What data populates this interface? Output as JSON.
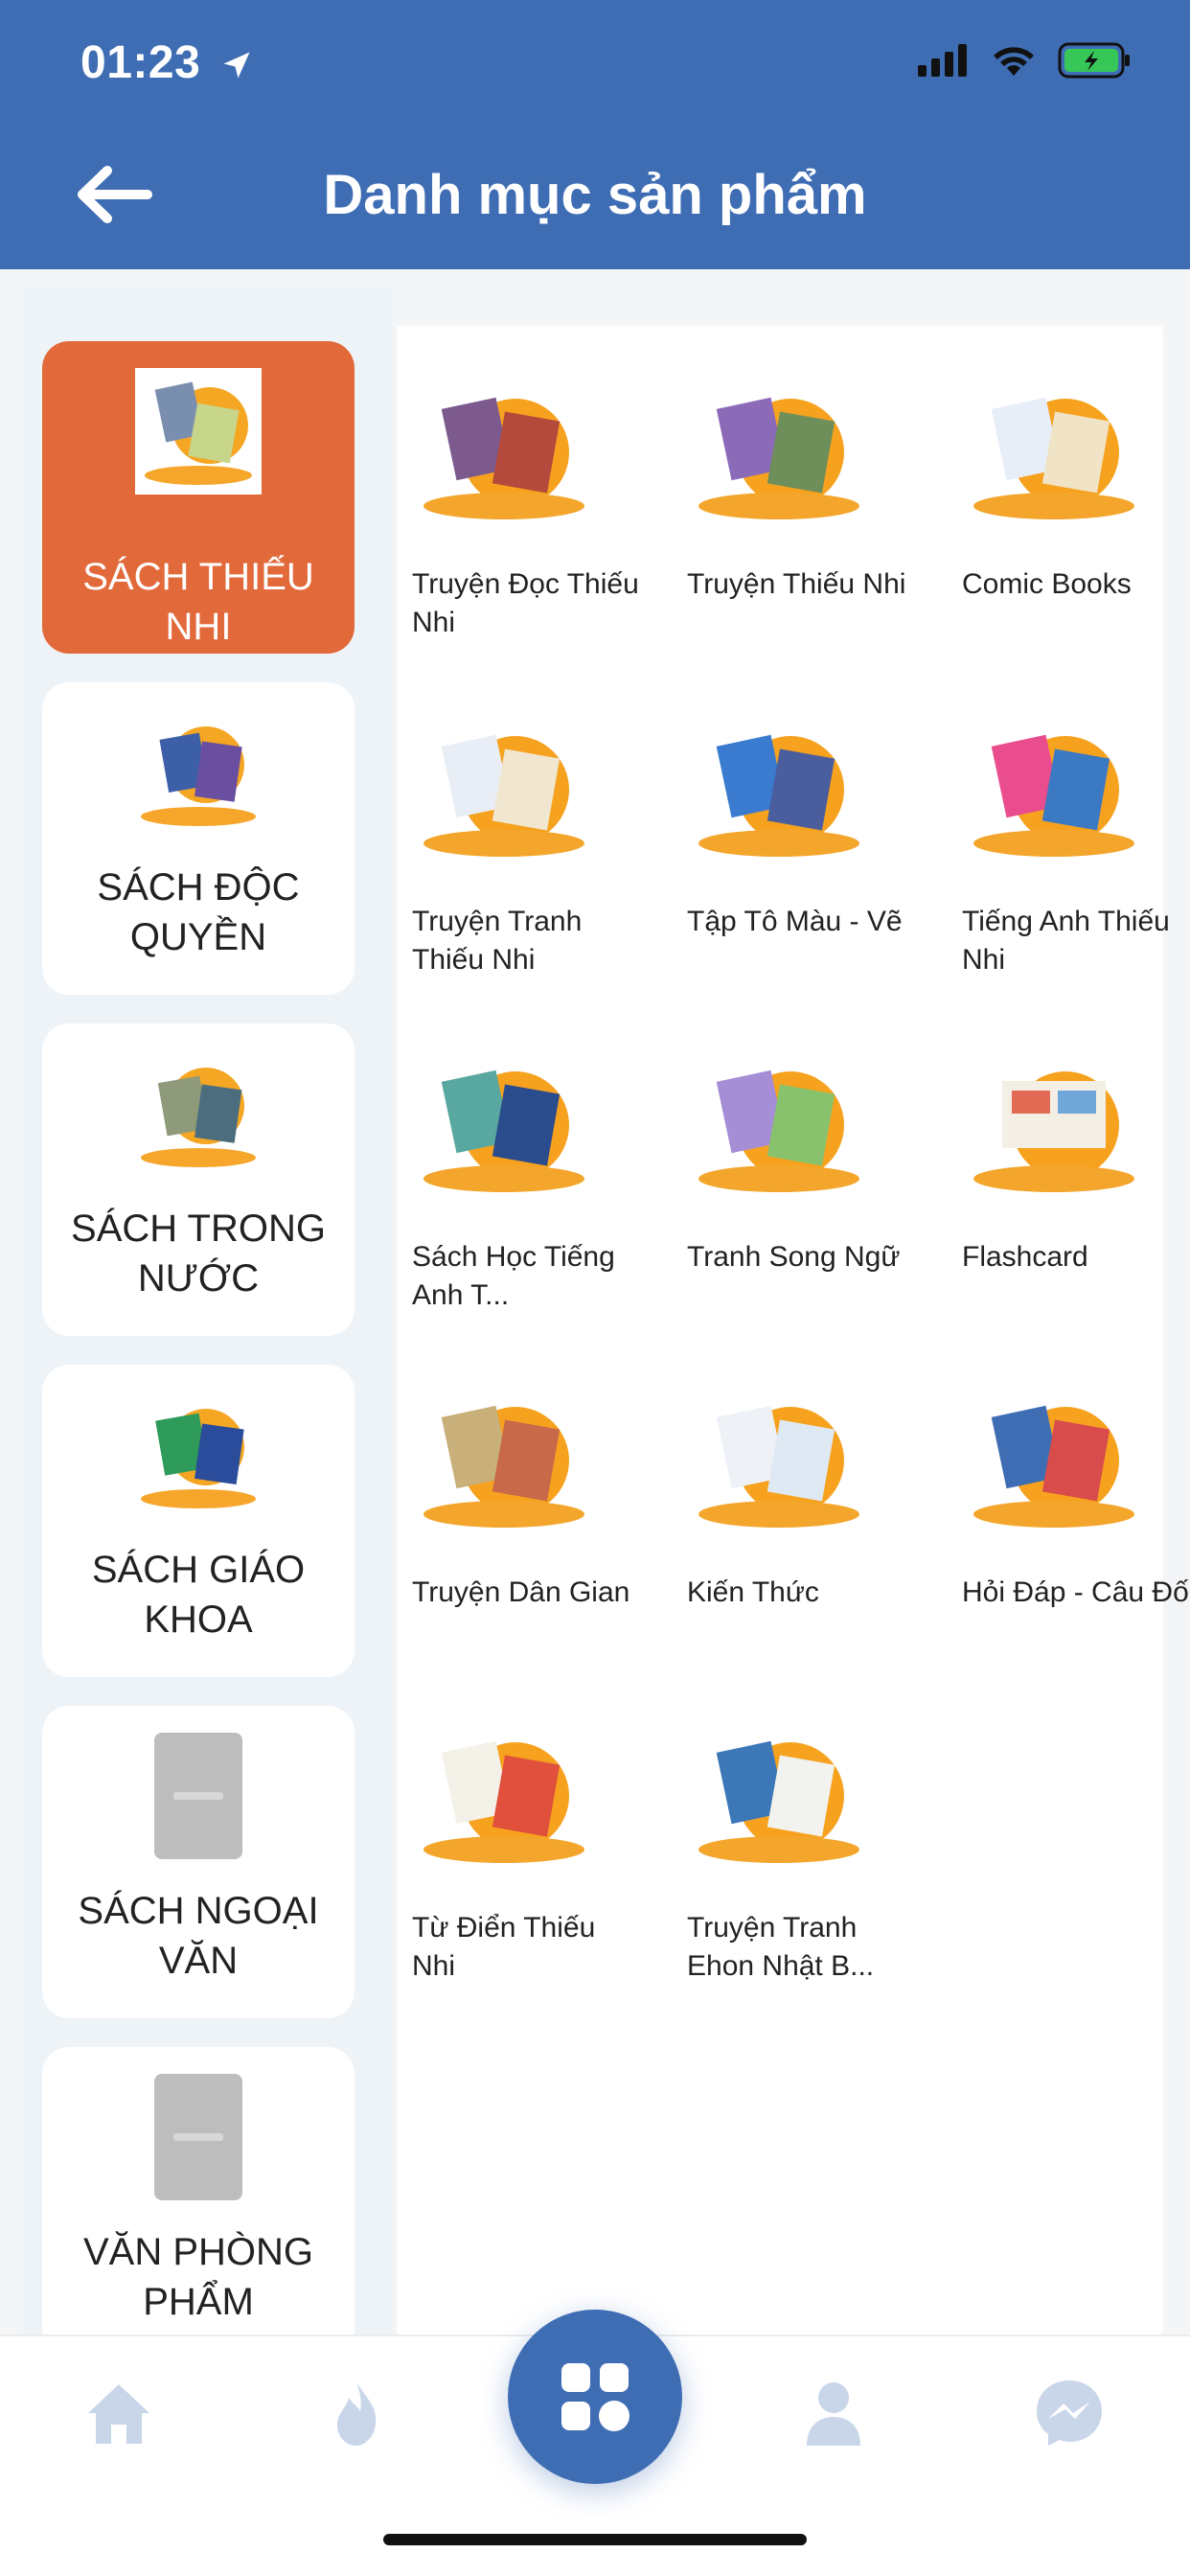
{
  "status": {
    "time": "01:23"
  },
  "header": {
    "title": "Danh mục sản phẩm"
  },
  "sidebar": {
    "items": [
      {
        "label": "SÁCH THIẾU NHI",
        "active": true
      },
      {
        "label": "SÁCH ĐỘC QUYỀN"
      },
      {
        "label": "SÁCH TRONG NƯỚC"
      },
      {
        "label": "SÁCH GIÁO KHOA"
      },
      {
        "label": "SÁCH NGOẠI VĂN"
      },
      {
        "label": "VĂN PHÒNG PHẨM"
      }
    ]
  },
  "grid": {
    "items": [
      {
        "label": "Truyện Đọc Thiếu Nhi"
      },
      {
        "label": "Truyện Thiếu Nhi"
      },
      {
        "label": "Comic Books"
      },
      {
        "label": "Truyện Tranh Thiếu Nhi"
      },
      {
        "label": "Tập Tô Màu - Vẽ"
      },
      {
        "label": "Tiếng Anh Thiếu Nhi"
      },
      {
        "label": "Sách Học Tiếng Anh T..."
      },
      {
        "label": "Tranh Song Ngữ"
      },
      {
        "label": "Flashcard"
      },
      {
        "label": "Truyện Dân Gian"
      },
      {
        "label": "Kiến Thức"
      },
      {
        "label": "Hỏi Đáp - Câu Đố"
      },
      {
        "label": "Từ Điển Thiếu Nhi"
      },
      {
        "label": "Truyện Tranh Ehon Nhật B..."
      }
    ]
  },
  "bottom_nav": {
    "items": [
      "home-icon",
      "fire-icon",
      "grid-icon",
      "user-icon",
      "messenger-icon"
    ]
  },
  "colors": {
    "header": "#3f6db4",
    "active": "#e2693a",
    "icon_inactive": "#c9d6ea"
  }
}
